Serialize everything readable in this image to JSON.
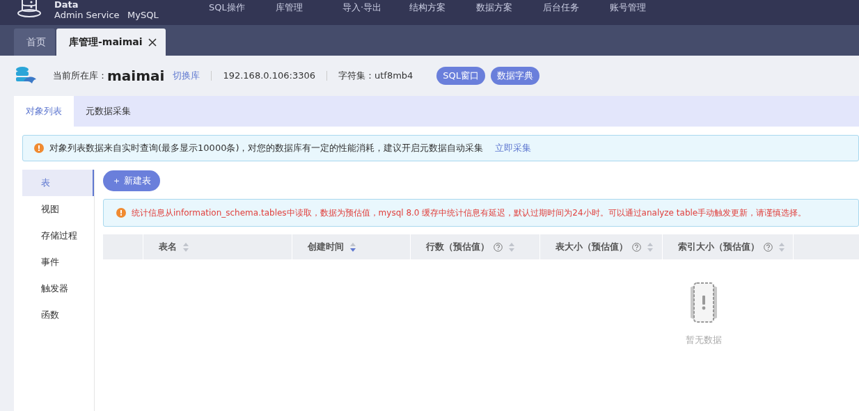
{
  "brand": {
    "line1": "Data",
    "line2": "Admin Service",
    "product": "MySQL"
  },
  "menu": [
    {
      "label": "SQL操作"
    },
    {
      "label": "库管理"
    },
    {
      "label": "导入·导出"
    },
    {
      "label": "结构方案"
    },
    {
      "label": "数据方案"
    },
    {
      "label": "后台任务"
    },
    {
      "label": "账号管理"
    }
  ],
  "page_tabs": [
    {
      "label": "首页",
      "selected": false,
      "closable": false
    },
    {
      "label": "库管理-maimai",
      "selected": true,
      "closable": true
    }
  ],
  "db_header": {
    "prefix": "当前所在库：",
    "db_name": "maimai",
    "switch_link": "切换库",
    "host": "192.168.0.106:3306",
    "charset": "字符集：utf8mb4",
    "buttons": [
      "SQL窗口",
      "数据字典"
    ]
  },
  "tabs": [
    {
      "label": "对象列表",
      "selected": true
    },
    {
      "label": "元数据采集",
      "selected": false
    }
  ],
  "notice": {
    "text": "对象列表数据来自实时查询(最多显示10000条)，对您的数据库有一定的性能消耗，建议开启元数据自动采集",
    "link": "立即采集"
  },
  "side_menu": [
    {
      "label": "表",
      "selected": true
    },
    {
      "label": "视图",
      "selected": false
    },
    {
      "label": "存储过程",
      "selected": false
    },
    {
      "label": "事件",
      "selected": false
    },
    {
      "label": "触发器",
      "selected": false
    },
    {
      "label": "函数",
      "selected": false
    }
  ],
  "new_button": {
    "icon": "＋",
    "label": "新建表"
  },
  "stats_warning": "统计信息从information_schema.tables中读取，数据为预估值，mysql 8.0 缓存中统计信息有延迟，默认过期时间为24小时。可以通过analyze table手动触发更新，请谨慎选择。",
  "table": {
    "columns": [
      {
        "label": "表名",
        "help": false,
        "sorted_desc": false
      },
      {
        "label": "创建时间",
        "help": false,
        "sorted_desc": true
      },
      {
        "label": "行数（预估值）",
        "help": true,
        "sorted_desc": false
      },
      {
        "label": "表大小（预估值）",
        "help": true,
        "sorted_desc": false
      },
      {
        "label": "索引大小（预估值）",
        "help": true,
        "sorted_desc": false
      }
    ],
    "empty_text": "暂无数据"
  }
}
